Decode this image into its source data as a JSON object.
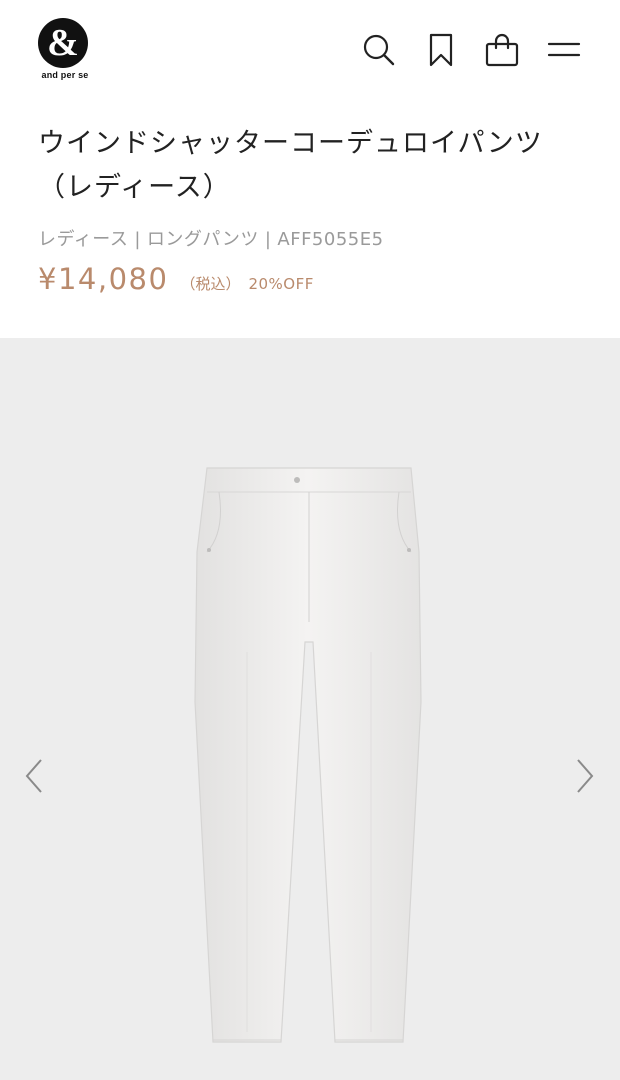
{
  "header": {
    "logo_text": "and per se",
    "logo_symbol": "&",
    "icons": [
      "search-icon",
      "favorite-bookmark-icon",
      "shopping-bag-icon",
      "menu-icon"
    ]
  },
  "product": {
    "title": "ウインドシャッターコーデュロイパンツ（レディース）",
    "meta": {
      "gender": "レディース",
      "category": "ロングパンツ",
      "code": "AFF5055E5",
      "separator": "|"
    },
    "price": {
      "value": "¥14,080",
      "tax_label": "（税込）",
      "discount": "20%OFF"
    }
  },
  "gallery": {
    "image_alt": "white corduroy pants",
    "prev_icon": "chevron-left-icon",
    "next_icon": "chevron-right-icon"
  },
  "colors": {
    "price": "#b98a6c",
    "meta": "#9a9a9a",
    "text": "#222222",
    "gallery_bg": "#ededed"
  }
}
